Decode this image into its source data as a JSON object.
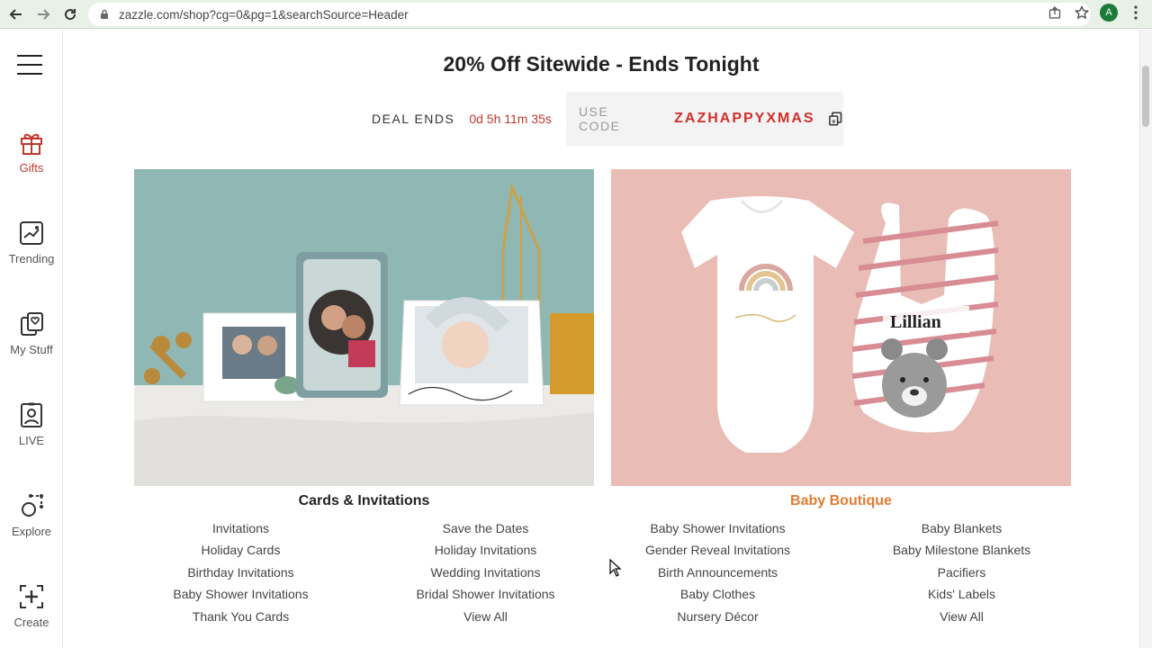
{
  "browser": {
    "url": "zazzle.com/shop?cg=0&pg=1&searchSource=Header",
    "profile_initial": "A"
  },
  "rail": {
    "items": [
      {
        "label": "Gifts",
        "icon": "gift-icon"
      },
      {
        "label": "Trending",
        "icon": "trending-icon"
      },
      {
        "label": "My Stuff",
        "icon": "my-stuff-icon"
      },
      {
        "label": "LIVE",
        "icon": "live-icon"
      },
      {
        "label": "Explore",
        "icon": "explore-icon"
      },
      {
        "label": "Create",
        "icon": "create-icon"
      }
    ]
  },
  "promo": {
    "title": "20% Off Sitewide - Ends Tonight",
    "deal_label": "DEAL ENDS",
    "timer": "0d 5h 11m 35s",
    "use_code_label": "USE CODE",
    "code": "ZAZHAPPYXMAS"
  },
  "categories": [
    {
      "title": "Cards & Invitations",
      "col1": [
        "Invitations",
        "Holiday Cards",
        "Birthday Invitations",
        "Baby Shower Invitations",
        "Thank You Cards"
      ],
      "col2": [
        "Save the Dates",
        "Holiday Invitations",
        "Wedding Invitations",
        "Bridal Shower Invitations",
        "View All"
      ]
    },
    {
      "title": "Baby Boutique",
      "col1": [
        "Baby Shower Invitations",
        "Gender Reveal Invitations",
        "Birth Announcements",
        "Baby Clothes",
        "Nursery Décor"
      ],
      "col2": [
        "Baby Blankets",
        "Baby Milestone Blankets",
        "Pacifiers",
        "Kids' Labels",
        "View All"
      ]
    }
  ],
  "images": {
    "baby_bib_name": "Lillian"
  },
  "colors": {
    "accent_red": "#d0302b",
    "baby_boutique_orange": "#e27b32",
    "gifts_icon_red": "#c0392b"
  }
}
